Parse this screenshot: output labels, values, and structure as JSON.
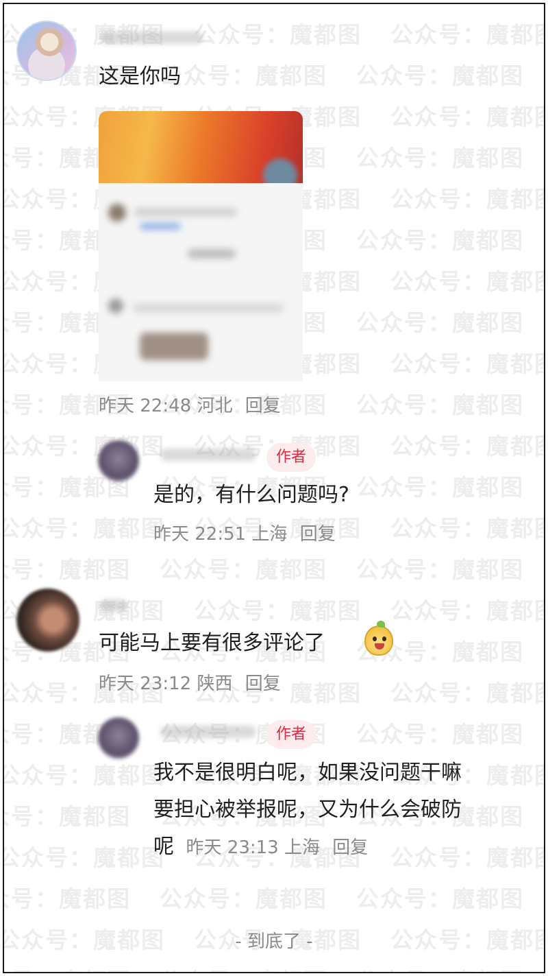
{
  "watermark": {
    "text": "公众号：魔都图"
  },
  "comments": [
    {
      "text": "这是你吗",
      "time": "昨天 22:48",
      "location": "河北",
      "reply_label": "回复"
    },
    {
      "badge": "作者",
      "text": "是的，有什么问题吗?",
      "time": "昨天 22:51",
      "location": "上海",
      "reply_label": "回复"
    },
    {
      "text": "可能马上要有很多评论了",
      "time": "昨天 23:12",
      "location": "陕西",
      "reply_label": "回复"
    },
    {
      "badge": "作者",
      "text_line1": "我不是很明白呢，如果没问题干嘛",
      "text_line2": "要担心被举报呢，又为什么会破防",
      "text_line3": "呢",
      "time": "昨天 23:13",
      "location": "上海",
      "reply_label": "回复"
    }
  ],
  "footer": {
    "end_text": "- 到底了 -"
  }
}
